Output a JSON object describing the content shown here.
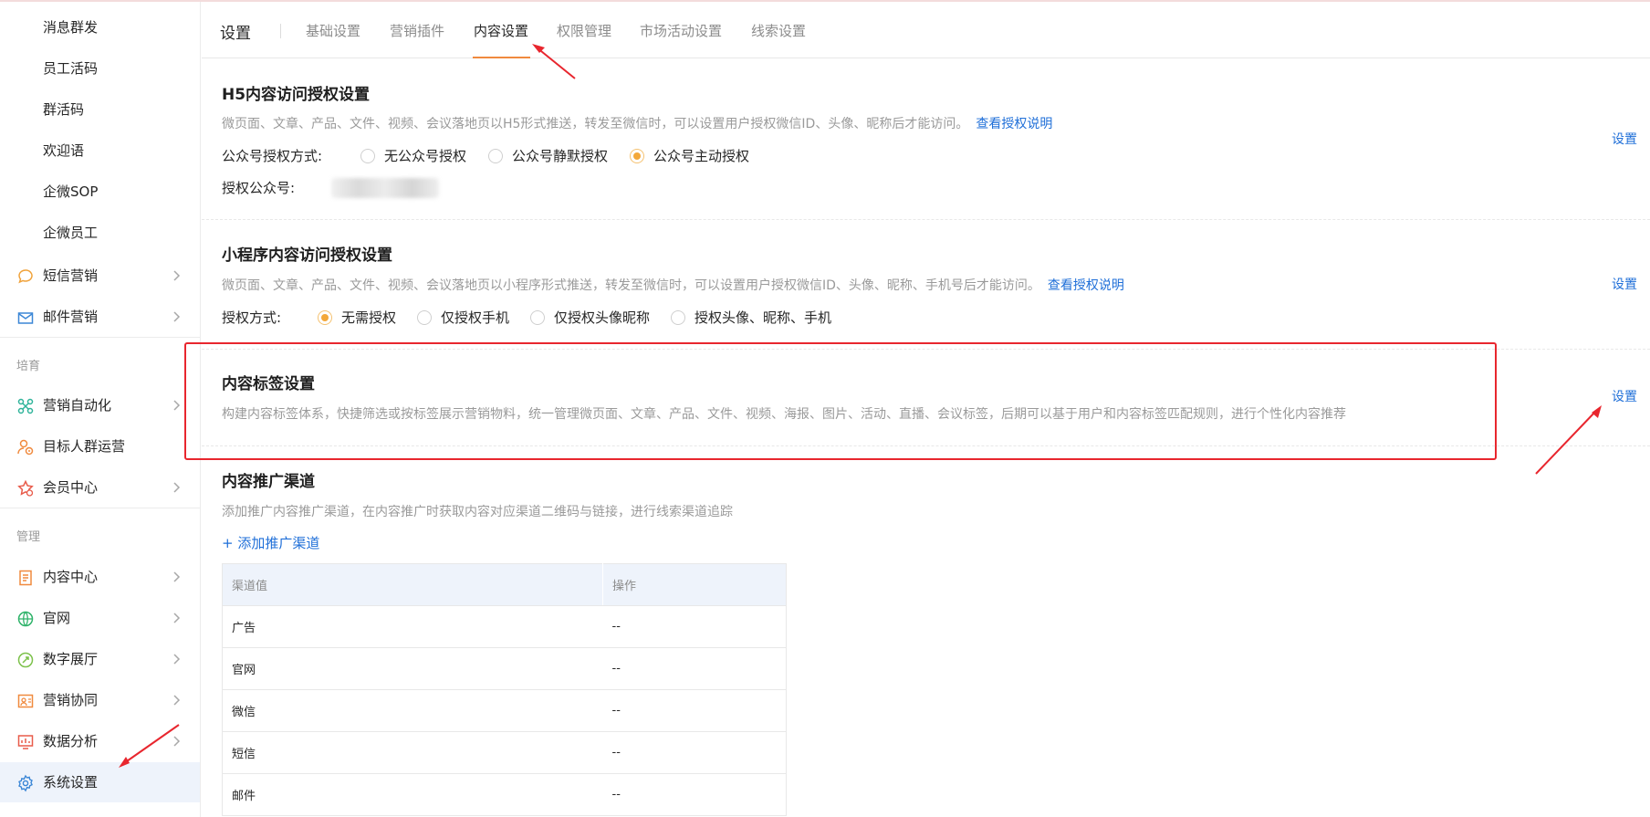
{
  "sidebar": {
    "sub_items": [
      "消息群发",
      "员工活码",
      "群活码",
      "欢迎语",
      "企微SOP",
      "企微员工"
    ],
    "groups1": [
      {
        "label": "短信营销",
        "icon": "chat-bubble-icon"
      },
      {
        "label": "邮件营销",
        "icon": "mail-icon"
      }
    ],
    "section_cultivate": "培育",
    "groups2": [
      {
        "label": "营销自动化",
        "icon": "automation-icon"
      },
      {
        "label": "目标人群运营",
        "icon": "target-audience-icon"
      },
      {
        "label": "会员中心",
        "icon": "member-star-icon"
      }
    ],
    "section_manage": "管理",
    "groups3": [
      {
        "label": "内容中心",
        "icon": "document-icon"
      },
      {
        "label": "官网",
        "icon": "globe-icon"
      },
      {
        "label": "数字展厅",
        "icon": "digital-hall-icon"
      },
      {
        "label": "营销协同",
        "icon": "collaboration-icon"
      },
      {
        "label": "数据分析",
        "icon": "chart-icon"
      }
    ],
    "active_item": {
      "label": "系统设置",
      "icon": "gear-icon"
    }
  },
  "tabs": {
    "title": "设置",
    "items": [
      "基础设置",
      "营销插件",
      "内容设置",
      "权限管理",
      "市场活动设置",
      "线索设置"
    ],
    "active": "内容设置"
  },
  "h5": {
    "title": "H5内容访问授权设置",
    "desc": "微页面、文章、产品、文件、视频、会议落地页以H5形式推送，转发至微信时，可以设置用户授权微信ID、头像、昵称后才能访问。",
    "link": "查看授权说明",
    "setting": "设置",
    "auth_label": "公众号授权方式:",
    "options": [
      "无公众号授权",
      "公众号静默授权",
      "公众号主动授权"
    ],
    "selected": "公众号主动授权",
    "account_label": "授权公众号:"
  },
  "miniprogram": {
    "title": "小程序内容访问授权设置",
    "desc": "微页面、文章、产品、文件、视频、会议落地页以小程序形式推送，转发至微信时，可以设置用户授权微信ID、头像、昵称、手机号后才能访问。",
    "link": "查看授权说明",
    "setting": "设置",
    "auth_label": "授权方式:",
    "options": [
      "无需授权",
      "仅授权手机",
      "仅授权头像昵称",
      "授权头像、昵称、手机"
    ],
    "selected": "无需授权"
  },
  "tags": {
    "title": "内容标签设置",
    "desc": "构建内容标签体系，快捷筛选或按标签展示营销物料，统一管理微页面、文章、产品、文件、视频、海报、图片、活动、直播、会议标签，后期可以基于用户和内容标签匹配规则，进行个性化内容推荐",
    "setting": "设置"
  },
  "channels": {
    "title": "内容推广渠道",
    "desc": "添加推广内容推广渠道，在内容推广时获取内容对应渠道二维码与链接，进行线索渠道追踪",
    "add_label": "+ 添加推广渠道",
    "columns": [
      "渠道值",
      "操作"
    ],
    "rows": [
      {
        "name": "广告",
        "op": "--"
      },
      {
        "name": "官网",
        "op": "--"
      },
      {
        "name": "微信",
        "op": "--"
      },
      {
        "name": "短信",
        "op": "--"
      },
      {
        "name": "邮件",
        "op": "--"
      }
    ]
  },
  "colors": {
    "accent_orange": "#f08a3e",
    "link_blue": "#1f6fd8",
    "highlight_red": "#e8262e",
    "active_bg": "#eef3fb"
  }
}
